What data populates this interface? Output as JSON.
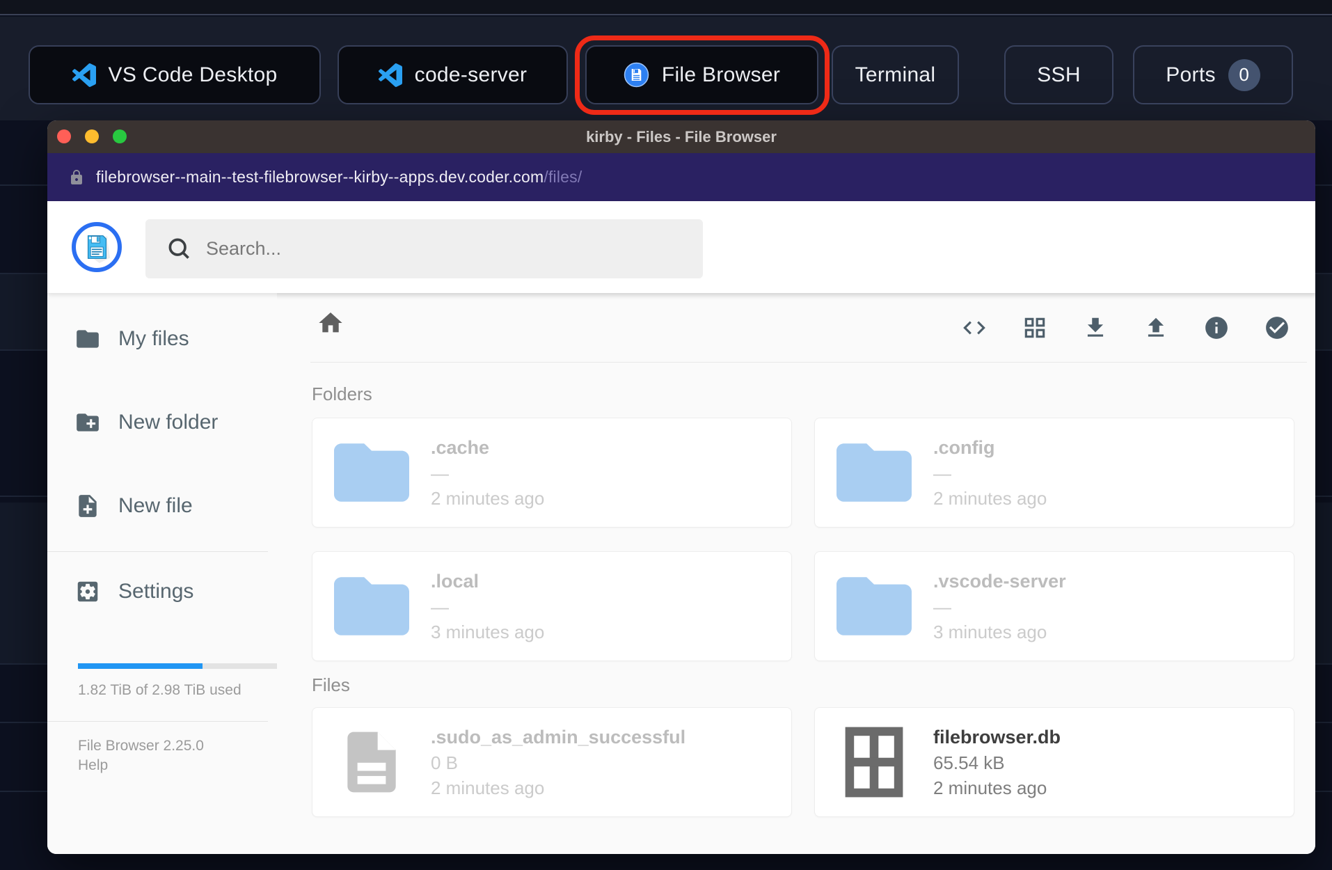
{
  "topbar": {
    "tabs": [
      {
        "label": "VS Code Desktop",
        "icon": "vscode-icon"
      },
      {
        "label": "code-server",
        "icon": "vscode-icon"
      },
      {
        "label": "File Browser",
        "icon": "filebrowser-icon",
        "highlighted": true
      },
      {
        "label": "Terminal"
      },
      {
        "label": "SSH"
      },
      {
        "label": "Ports",
        "badge": "0"
      }
    ]
  },
  "window": {
    "title": "kirby - Files - File Browser",
    "url": {
      "domain": "filebrowser--main--test-filebrowser--kirby--apps.dev.coder.com",
      "path": "/files/"
    }
  },
  "app_header": {
    "search_placeholder": "Search...",
    "icons": [
      "code-icon",
      "grid-view-icon",
      "download-icon",
      "upload-icon",
      "info-icon",
      "check-circle-icon"
    ]
  },
  "sidebar": {
    "items": [
      {
        "label": "My files",
        "icon": "folder-icon"
      },
      {
        "label": "New folder",
        "icon": "new-folder-icon"
      },
      {
        "label": "New file",
        "icon": "new-file-icon"
      },
      {
        "label": "Settings",
        "icon": "settings-icon"
      }
    ],
    "usage": {
      "label": "1.82 TiB of 2.98 TiB used",
      "percent_used": 62
    },
    "version": "File Browser 2.25.0",
    "help": "Help"
  },
  "listing": {
    "sections": [
      {
        "heading": "Folders",
        "items": [
          {
            "name": ".cache",
            "size": "—",
            "modified": "2 minutes ago",
            "type": "folder",
            "dimmed": true
          },
          {
            "name": ".config",
            "size": "—",
            "modified": "2 minutes ago",
            "type": "folder",
            "dimmed": true
          },
          {
            "name": ".local",
            "size": "—",
            "modified": "3 minutes ago",
            "type": "folder",
            "dimmed": true
          },
          {
            "name": ".vscode-server",
            "size": "—",
            "modified": "3 minutes ago",
            "type": "folder",
            "dimmed": true
          }
        ]
      },
      {
        "heading": "Files",
        "items": [
          {
            "name": ".sudo_as_admin_successful",
            "size": "0 B",
            "modified": "2 minutes ago",
            "type": "file",
            "dimmed": true
          },
          {
            "name": "filebrowser.db",
            "size": "65.54 kB",
            "modified": "2 minutes ago",
            "type": "database",
            "dimmed": false
          }
        ]
      }
    ]
  },
  "colors": {
    "accent_blue": "#2b6ff2",
    "progress_blue": "#2196f3",
    "annotation_red": "#ee2a17",
    "url_bar_purple": "#2a2162",
    "titlebar_brown": "#3a3331",
    "folder_icon_blue": "#a9cef2",
    "header_icon_slate": "#4d5e6a"
  }
}
